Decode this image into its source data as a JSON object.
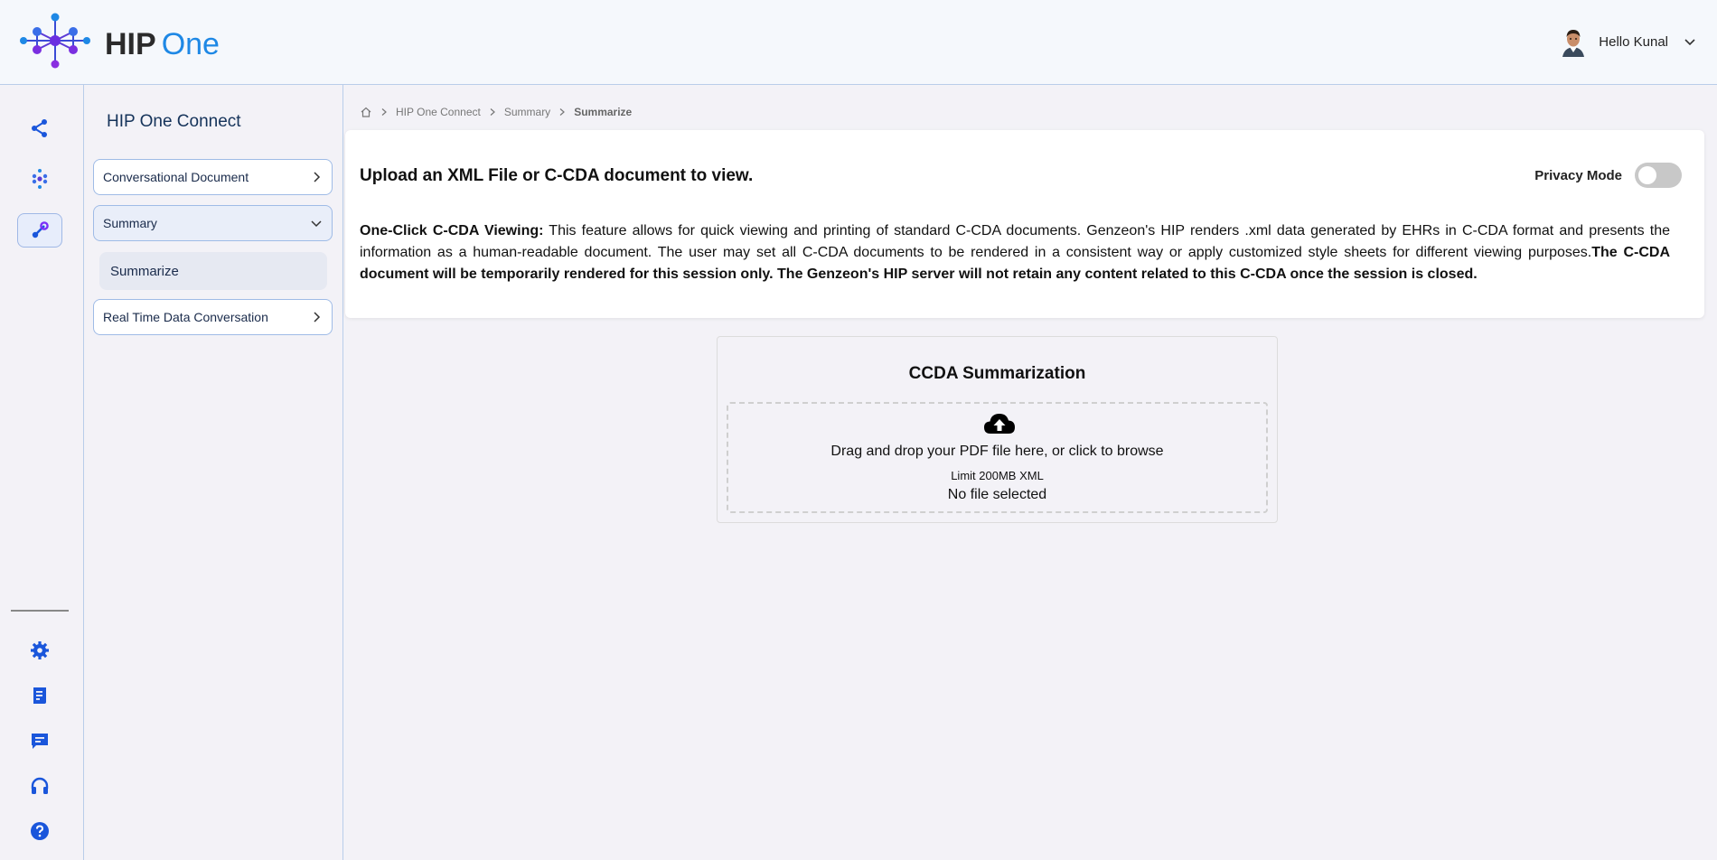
{
  "app": {
    "brand_bold": "HIP",
    "brand_light": "One"
  },
  "user": {
    "greeting": "Hello Kunal"
  },
  "rail": {
    "icons": [
      "connect-icon",
      "network-icon",
      "integration-icon",
      "settings-icon",
      "document-icon",
      "chat-icon",
      "support-icon",
      "help-icon"
    ],
    "active_color": "#7b2ff7",
    "icon_color": "#1a56db"
  },
  "subnav": {
    "title": "HIP One Connect",
    "items": [
      {
        "label": "Conversational Document"
      },
      {
        "label": "Summary"
      },
      {
        "label": "Real Time Data Conversation"
      }
    ],
    "sub_item": "Summarize"
  },
  "breadcrumb": {
    "items": [
      "HIP One Connect",
      "Summary",
      "Summarize"
    ]
  },
  "card": {
    "title": "Upload an XML File or C-CDA document to view.",
    "privacy_label": "Privacy Mode",
    "privacy_on": false,
    "desc_lead": "One-Click C-CDA Viewing:",
    "desc_body": " This feature allows for quick viewing and printing of standard C-CDA documents. Genzeon's HIP renders .xml data generated by EHRs in C-CDA format and presents the information as a human-readable document. The user may set all C-CDA documents to be rendered in a consistent way or apply customized style sheets for different viewing purposes.",
    "desc_bold": "The C-CDA document will be temporarily rendered for this session only. The Genzeon's HIP server will not retain any content related to this C-CDA once the session is closed."
  },
  "upload": {
    "title": "CCDA Summarization",
    "drop_text": "Drag and drop your PDF file here, or click to browse",
    "limit_text": "Limit 200MB XML",
    "file_status": "No file selected"
  }
}
